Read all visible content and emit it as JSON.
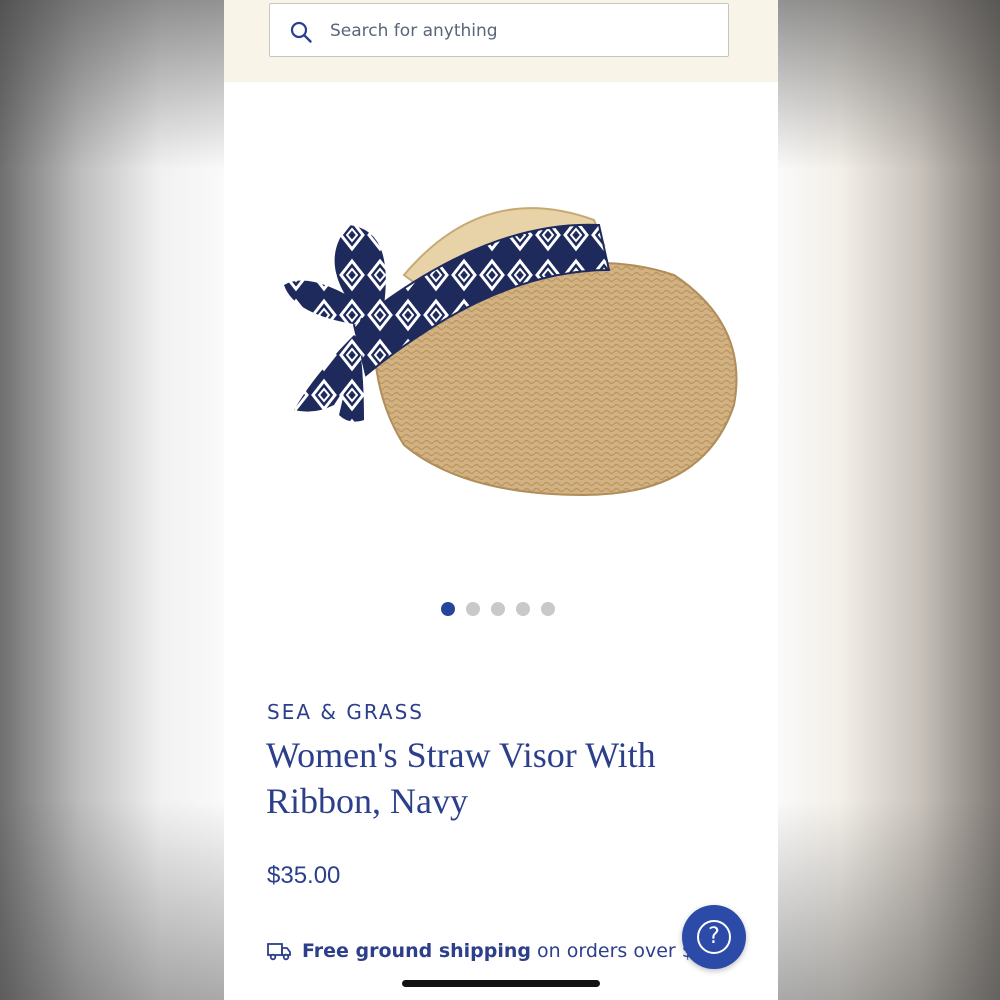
{
  "search": {
    "placeholder": "Search for anything",
    "icon": "search-icon"
  },
  "gallery": {
    "image_alt": "Women's Straw Visor With Ribbon, Navy",
    "total_images": 5,
    "active_index": 0
  },
  "product": {
    "brand": "SEA & GRASS",
    "title": "Women's Straw Visor With Ribbon, Navy",
    "price": "$35.00"
  },
  "shipping": {
    "bold": "Free ground shipping",
    "rest": "on orders over $95"
  },
  "help": {
    "label": "?"
  },
  "colors": {
    "accent": "#2c3f8a",
    "dot_active": "#26449b",
    "dot_inactive": "#c9c9c9",
    "header_bg": "#f8f5e8",
    "help_bg": "#2c4aa8"
  }
}
